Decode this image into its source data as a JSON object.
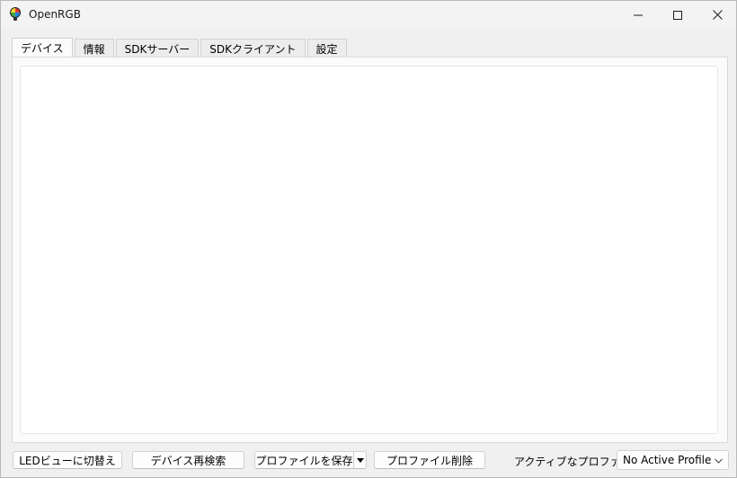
{
  "window": {
    "title": "OpenRGB",
    "controls": {
      "minimize": "—",
      "maximize": "☐",
      "close": "✕"
    }
  },
  "tabs": [
    {
      "label": "デバイス",
      "active": true
    },
    {
      "label": "情報",
      "active": false
    },
    {
      "label": "SDKサーバー",
      "active": false
    },
    {
      "label": "SDKクライアント",
      "active": false
    },
    {
      "label": "設定",
      "active": false
    }
  ],
  "footer": {
    "led_view_button": "LEDビューに切替え",
    "rescan_button": "デバイス再検索",
    "save_profile_button": "プロファイルを保存",
    "delete_profile_button": "プロファイル削除",
    "active_profile_label": "アクティブなプロファイル:",
    "active_profile_value": "No Active Profile"
  },
  "colors": {
    "window_bg": "#f0f0f0",
    "pane_bg": "#fbfbfb",
    "panel_bg": "#ffffff",
    "border": "#d0d0d0"
  },
  "icons": [
    "openrgb-logo-icon",
    "minimize-icon",
    "maximize-icon",
    "close-icon",
    "dropdown-arrow-icon",
    "chevron-down-icon"
  ]
}
